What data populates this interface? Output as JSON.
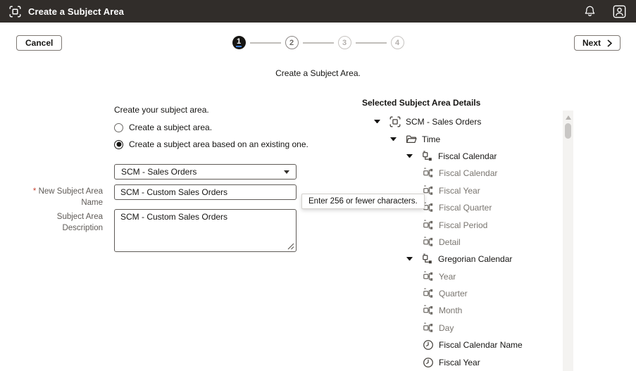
{
  "header": {
    "title": "Create a Subject Area"
  },
  "wizard": {
    "cancel_label": "Cancel",
    "next_label": "Next",
    "subtitle": "Create a Subject Area.",
    "steps": [
      {
        "number": "1",
        "state": "current"
      },
      {
        "number": "2",
        "state": "next"
      },
      {
        "number": "3",
        "state": "upcoming"
      },
      {
        "number": "4",
        "state": "upcoming"
      }
    ]
  },
  "form": {
    "section_title": "Create your subject area.",
    "required_marker": "*",
    "radios": [
      {
        "label": "Create a subject area.",
        "selected": false
      },
      {
        "label": "Create a subject area based on an existing one.",
        "selected": true
      }
    ],
    "source_select": {
      "value": "SCM - Sales Orders"
    },
    "name_field": {
      "label": "New Subject Area Name",
      "required": true,
      "value": "SCM - Custom Sales Orders"
    },
    "description_field": {
      "label": "Subject Area Description",
      "value": "SCM - Custom Sales Orders"
    },
    "tooltip": "Enter 256 or fewer characters."
  },
  "tree": {
    "title": "Selected Subject Area Details",
    "items": [
      {
        "label": "SCM - Sales Orders",
        "icon": "subject-area",
        "depth": 0,
        "caret": true,
        "muted": false
      },
      {
        "label": "Time",
        "icon": "folder",
        "depth": 1,
        "caret": true,
        "muted": false
      },
      {
        "label": "Fiscal Calendar",
        "icon": "hierarchy",
        "depth": 2,
        "caret": true,
        "muted": false
      },
      {
        "label": "Fiscal Calendar",
        "icon": "level",
        "depth": 3,
        "caret": false,
        "muted": true
      },
      {
        "label": "Fiscal Year",
        "icon": "level",
        "depth": 3,
        "caret": false,
        "muted": true
      },
      {
        "label": "Fiscal Quarter",
        "icon": "level",
        "depth": 3,
        "caret": false,
        "muted": true
      },
      {
        "label": "Fiscal Period",
        "icon": "level",
        "depth": 3,
        "caret": false,
        "muted": true
      },
      {
        "label": "Detail",
        "icon": "level",
        "depth": 3,
        "caret": false,
        "muted": true
      },
      {
        "label": "Gregorian Calendar",
        "icon": "hierarchy",
        "depth": 2,
        "caret": true,
        "muted": false
      },
      {
        "label": "Year",
        "icon": "level",
        "depth": 3,
        "caret": false,
        "muted": true
      },
      {
        "label": "Quarter",
        "icon": "level",
        "depth": 3,
        "caret": false,
        "muted": true
      },
      {
        "label": "Month",
        "icon": "level",
        "depth": 3,
        "caret": false,
        "muted": true
      },
      {
        "label": "Day",
        "icon": "level",
        "depth": 3,
        "caret": false,
        "muted": true
      },
      {
        "label": "Fiscal Calendar Name",
        "icon": "clock",
        "depth": 3,
        "caret": false,
        "muted": false
      },
      {
        "label": "Fiscal Year",
        "icon": "clock",
        "depth": 3,
        "caret": false,
        "muted": false
      }
    ]
  },
  "colors": {
    "header_bg": "#312d2a",
    "dark_text": "#161513",
    "muted_text": "#79756f",
    "accent_blue": "#3b7dd8",
    "required_red": "#c74634"
  }
}
